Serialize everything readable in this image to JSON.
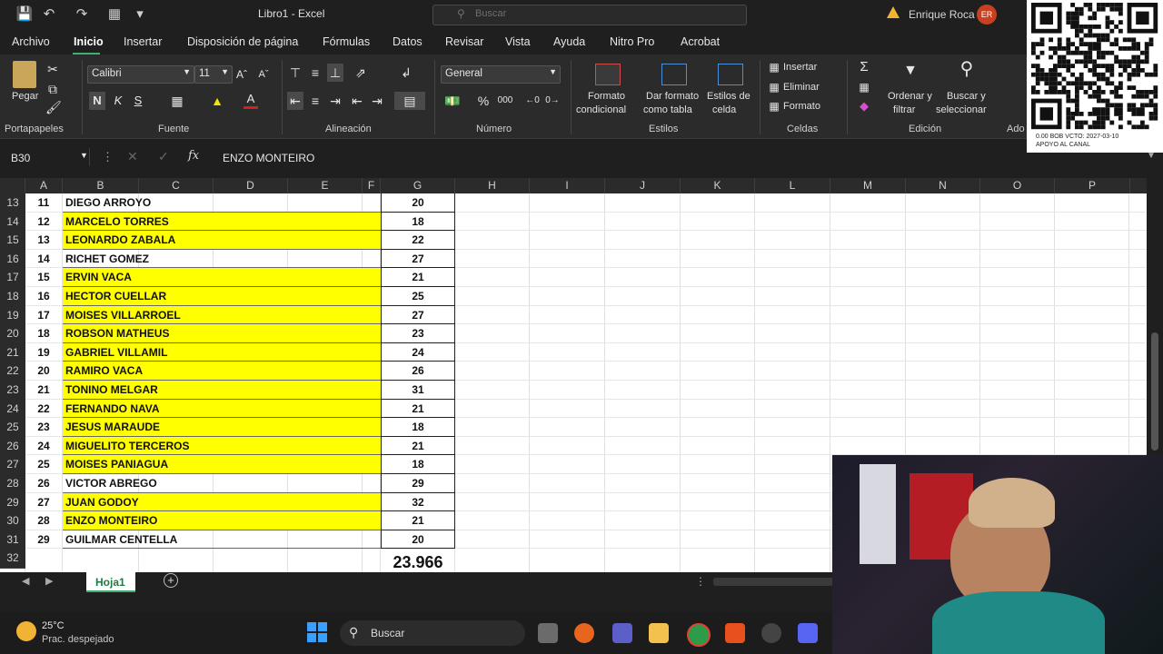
{
  "titlebar": {
    "doc_title": "Libro1  -  Excel",
    "search_placeholder": "Buscar",
    "user_name": "Enrique Roca",
    "user_initials": "ER"
  },
  "menu": {
    "tabs": [
      "Archivo",
      "Inicio",
      "Insertar",
      "Disposición de página",
      "Fórmulas",
      "Datos",
      "Revisar",
      "Vista",
      "Ayuda",
      "Nitro Pro",
      "Acrobat"
    ],
    "active": "Inicio"
  },
  "ribbon": {
    "clipboard": {
      "paste_label": "Pegar",
      "group": "Portapapeles"
    },
    "font": {
      "name": "Calibri",
      "size": "11",
      "group": "Fuente"
    },
    "alignment": {
      "group": "Alineación"
    },
    "number": {
      "format": "General",
      "group": "Número"
    },
    "styles": {
      "cond_format_1": "Formato",
      "cond_format_2": "condicional",
      "table_format_1": "Dar formato",
      "table_format_2": "como tabla",
      "cell_styles_1": "Estilos de",
      "cell_styles_2": "celda",
      "group": "Estilos"
    },
    "cells": {
      "insert": "Insertar",
      "delete": "Eliminar",
      "format": "Formato",
      "group": "Celdas"
    },
    "editing": {
      "sort_1": "Ordenar y",
      "sort_2": "filtrar",
      "find_1": "Buscar y",
      "find_2": "seleccionar",
      "group": "Edición"
    },
    "addins": {
      "group": "Ado"
    }
  },
  "formula_bar": {
    "name_box": "B30",
    "content": "ENZO MONTEIRO"
  },
  "columns": [
    "A",
    "B",
    "C",
    "D",
    "E",
    "F",
    "G",
    "H",
    "I",
    "J",
    "K",
    "L",
    "M",
    "N",
    "O",
    "P"
  ],
  "rows": [
    {
      "row": "13",
      "num": "11",
      "name": "DIEGO ARROYO",
      "value": "20",
      "highlight": false
    },
    {
      "row": "14",
      "num": "12",
      "name": "MARCELO TORRES",
      "value": "18",
      "highlight": true
    },
    {
      "row": "15",
      "num": "13",
      "name": "LEONARDO ZABALA",
      "value": "22",
      "highlight": true
    },
    {
      "row": "16",
      "num": "14",
      "name": "RICHET GOMEZ",
      "value": "27",
      "highlight": false
    },
    {
      "row": "17",
      "num": "15",
      "name": "ERVIN VACA",
      "value": "21",
      "highlight": true
    },
    {
      "row": "18",
      "num": "16",
      "name": "HECTOR CUELLAR",
      "value": "25",
      "highlight": true
    },
    {
      "row": "19",
      "num": "17",
      "name": "MOISES VILLARROEL",
      "value": "27",
      "highlight": true
    },
    {
      "row": "20",
      "num": "18",
      "name": "ROBSON MATHEUS",
      "value": "23",
      "highlight": true
    },
    {
      "row": "21",
      "num": "19",
      "name": "GABRIEL VILLAMIL",
      "value": "24",
      "highlight": true
    },
    {
      "row": "22",
      "num": "20",
      "name": "RAMIRO VACA",
      "value": "26",
      "highlight": true
    },
    {
      "row": "23",
      "num": "21",
      "name": "TONINO MELGAR",
      "value": "31",
      "highlight": true
    },
    {
      "row": "24",
      "num": "22",
      "name": "FERNANDO NAVA",
      "value": "21",
      "highlight": true
    },
    {
      "row": "25",
      "num": "23",
      "name": "JESUS MARAUDE",
      "value": "18",
      "highlight": true
    },
    {
      "row": "26",
      "num": "24",
      "name": "MIGUELITO TERCEROS",
      "value": "21",
      "highlight": true
    },
    {
      "row": "27",
      "num": "25",
      "name": "MOISES PANIAGUA",
      "value": "18",
      "highlight": true
    },
    {
      "row": "28",
      "num": "26",
      "name": "VICTOR ABREGO",
      "value": "29",
      "highlight": false
    },
    {
      "row": "29",
      "num": "27",
      "name": "JUAN GODOY",
      "value": "32",
      "highlight": true
    },
    {
      "row": "30",
      "num": "28",
      "name": "ENZO MONTEIRO",
      "value": "21",
      "highlight": true
    },
    {
      "row": "31",
      "num": "29",
      "name": "GUILMAR CENTELLA",
      "value": "20",
      "highlight": false
    }
  ],
  "total_row": {
    "row": "32",
    "value": "23.966"
  },
  "sheet": {
    "tab": "Hoja1"
  },
  "taskbar": {
    "temp": "25°C",
    "weather": "Prac. despejado",
    "search": "Buscar"
  },
  "qr": {
    "line1": "0.00 BOB   VCTO: 2027-03-10",
    "line2": "APOYO AL CANAL"
  },
  "colors": {
    "highlight": "#ffff00",
    "accent": "#3fb070"
  }
}
